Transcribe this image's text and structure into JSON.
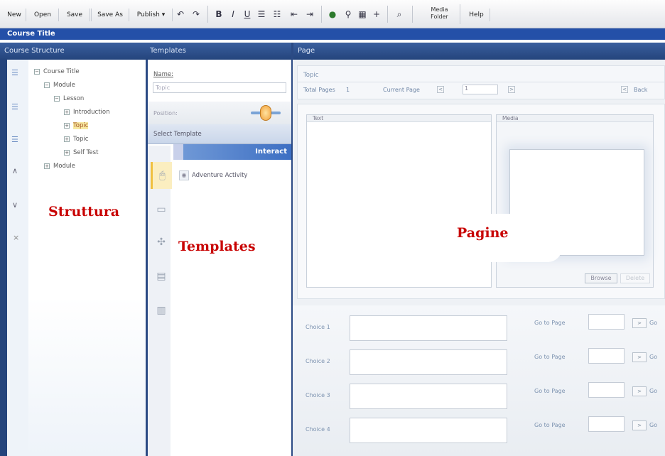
{
  "toolbar": {
    "buttons": [
      "New",
      "Open",
      "Save",
      "Save As",
      "Publish ▾"
    ],
    "format": [
      "B",
      "I",
      "U"
    ],
    "media_folder": "Media\nFolder",
    "help": "Help"
  },
  "course_bar": {
    "title": "Course Title"
  },
  "left": {
    "header": "Course Structure",
    "tree": [
      {
        "label": "Course Title",
        "toggle": "−",
        "level": 0,
        "highlight": false
      },
      {
        "label": "Module",
        "toggle": "−",
        "level": 1,
        "highlight": false
      },
      {
        "label": "Lesson",
        "toggle": "−",
        "level": 2,
        "highlight": false
      },
      {
        "label": "Introduction",
        "toggle": "+",
        "level": 3,
        "highlight": false
      },
      {
        "label": "Topic",
        "toggle": "+",
        "level": 3,
        "highlight": true
      },
      {
        "label": "Topic",
        "toggle": "+",
        "level": 3,
        "highlight": false
      },
      {
        "label": "Self Test",
        "toggle": "+",
        "level": 3,
        "highlight": false
      },
      {
        "label": "Module",
        "toggle": "+",
        "level": 1,
        "highlight": false
      }
    ],
    "overlay_label": "Struttura"
  },
  "templates": {
    "header": "Templates",
    "name_label": "Name:",
    "name_value": "Topic",
    "position_label": "Position:",
    "select_label": "Select Template",
    "tab_label": "Interact",
    "item_label": "Adventure Activity",
    "overlay_label": "Templates"
  },
  "page": {
    "header": "Page",
    "topic": "Topic",
    "total_pages_label": "Total Pages",
    "total_pages_value": "1",
    "current_page_label": "Current Page",
    "current_page_value": "1",
    "back_label": "Back",
    "text_label": "Text",
    "media_label": "Media",
    "browse_label": "Browse",
    "delete_label": "Delete",
    "overlay_label": "Pagine",
    "choices": [
      {
        "label": "Choice 1",
        "goto": "Go to Page",
        "go": "Go"
      },
      {
        "label": "Choice 2",
        "goto": "Go to Page",
        "go": "Go"
      },
      {
        "label": "Choice 3",
        "goto": "Go to Page",
        "go": "Go"
      },
      {
        "label": "Choice 4",
        "goto": "Go to Page",
        "go": "Go"
      }
    ]
  }
}
